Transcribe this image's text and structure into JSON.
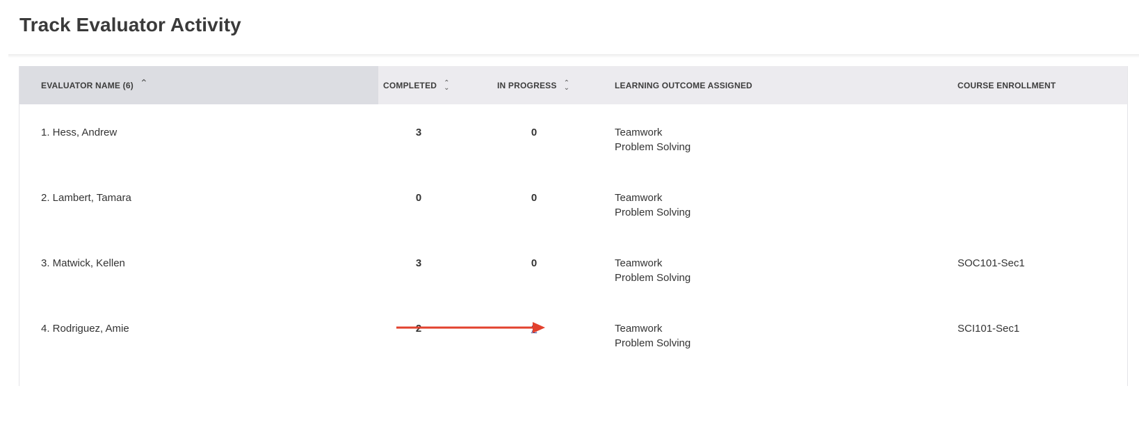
{
  "page": {
    "title": "Track Evaluator Activity"
  },
  "table": {
    "columns": {
      "evaluator": "EVALUATOR NAME (6)",
      "completed": "COMPLETED",
      "in_progress": "IN PROGRESS",
      "learning_outcome": "LEARNING OUTCOME ASSIGNED",
      "course_enrollment": "COURSE ENROLLMENT"
    },
    "sort": {
      "active_column": "evaluator",
      "direction": "ascending"
    },
    "rows": [
      {
        "name": "1. Hess, Andrew",
        "completed": "3",
        "in_progress": "0",
        "outcome_1": "Teamwork",
        "outcome_2": "Problem Solving",
        "course": ""
      },
      {
        "name": "2. Lambert, Tamara",
        "completed": "0",
        "in_progress": "0",
        "outcome_1": "Teamwork",
        "outcome_2": "Problem Solving",
        "course": ""
      },
      {
        "name": "3. Matwick, Kellen",
        "completed": "3",
        "in_progress": "0",
        "outcome_1": "Teamwork",
        "outcome_2": "Problem Solving",
        "course": "SOC101-Sec1"
      },
      {
        "name": "4. Rodriguez, Amie",
        "completed": "2",
        "in_progress": "1",
        "outcome_1": "Teamwork",
        "outcome_2": "Problem Solving",
        "course": "SCI101-Sec1"
      }
    ]
  },
  "annotation": {
    "arrow_color": "#e2412d"
  },
  "colors": {
    "header_bg": "#ecebef",
    "sorted_header_bg": "#dcdde2",
    "link": "#2b3a8f"
  }
}
